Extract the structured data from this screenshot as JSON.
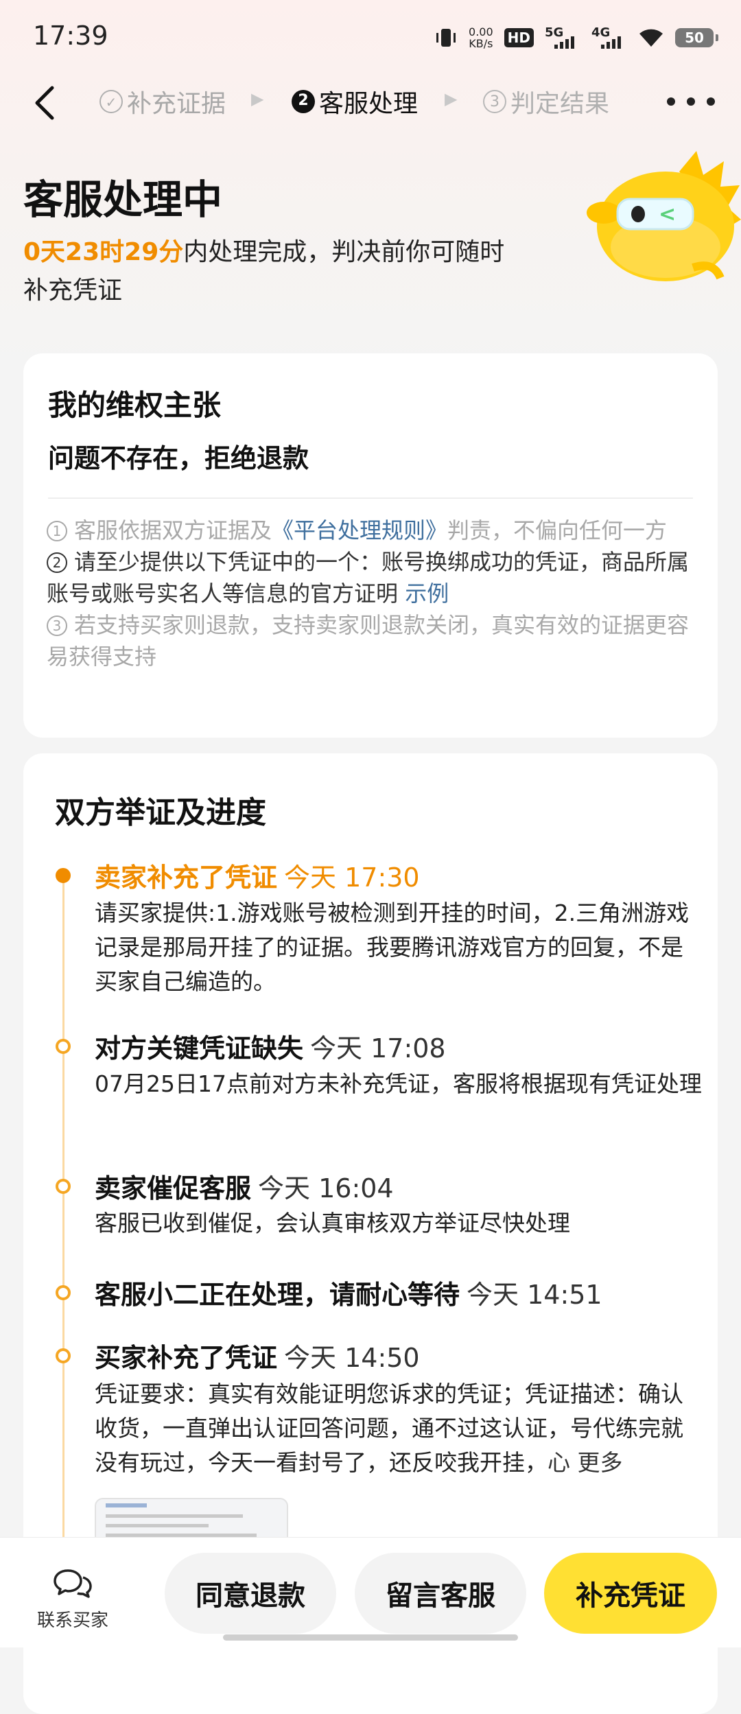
{
  "status_bar": {
    "time": "17:39",
    "net_speed_value": "0.00",
    "net_speed_unit": "KB/s",
    "hd_label": "HD",
    "sig1_label": "5G",
    "sig2_label": "4G",
    "battery": "50"
  },
  "nav": {
    "steps": [
      {
        "num": "✓",
        "label": "补充证据",
        "state": "done"
      },
      {
        "num": "2",
        "label": "客服处理",
        "state": "active"
      },
      {
        "num": "3",
        "label": "判定结果",
        "state": "pending"
      }
    ]
  },
  "header": {
    "title": "客服处理中",
    "countdown": "0天23时29分",
    "desc_suffix": "内处理完成，判决前你可随时",
    "desc_line2": "补充凭证"
  },
  "claim": {
    "heading": "我的维权主张",
    "value": "问题不存在，拒绝退款",
    "rules": [
      {
        "num": "1",
        "prefix": "客服依据双方证据及",
        "link": "《平台处理规则》",
        "suffix": "判责，不偏向任何一方"
      },
      {
        "num": "2",
        "prefix": "请至少提供以下凭证中的一个：账号换绑成功的凭证，商品所属账号或账号实名人等信息的官方证明",
        "link": "示例",
        "suffix": ""
      },
      {
        "num": "3",
        "prefix": "若支持买家则退款，支持卖家则退款关闭，真实有效的证据更容易获得支持",
        "link": "",
        "suffix": ""
      }
    ]
  },
  "progress": {
    "heading": "双方举证及进度",
    "events": [
      {
        "title": "卖家补充了凭证",
        "time": "今天 17:30",
        "body": "请买家提供:1.游戏账号被检测到开挂的时间，2.三角洲游戏记录是那局开挂了的证据。我要腾讯游戏官方的回复，不是买家自己编造的。"
      },
      {
        "title": "对方关键凭证缺失",
        "time": "今天 17:08",
        "body": "07月25日17点前对方未补充凭证，客服将根据现有凭证处理"
      },
      {
        "title": "卖家催促客服",
        "time": "今天 16:04",
        "body": "客服已收到催促，会认真审核双方举证尽快处理"
      },
      {
        "title": "客服小二正在处理，请耐心等待",
        "time": "今天 14:51",
        "body": ""
      },
      {
        "title": "买家补充了凭证",
        "time": "今天 14:50",
        "body": "凭证要求：真实有效能证明您诉求的凭证；凭证描述：确认收货，一直弹出认证回答问题，通不过这认证，号代练完就没有玩过，今天一看封号了，还反咬我开挂，",
        "more": "心 更多"
      }
    ]
  },
  "bottom": {
    "contact_label": "联系买家",
    "agree_label": "同意退款",
    "message_label": "留言客服",
    "supplement_label": "补充凭证"
  }
}
